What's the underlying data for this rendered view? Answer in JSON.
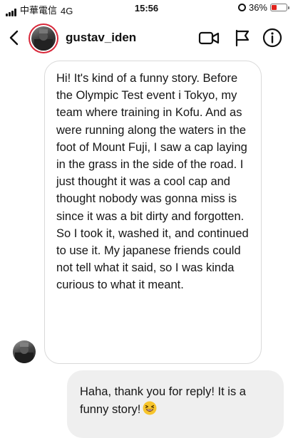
{
  "status_bar": {
    "carrier": "中華電信",
    "network": "4G",
    "time": "15:56",
    "battery": "36%"
  },
  "header": {
    "username": "gustav_iden"
  },
  "messages": [
    {
      "direction": "incoming",
      "text": "Hi! It's kind of a funny story. Before the Olympic Test event i Tokyo, my team where training in Kofu. And as were running along the waters in the foot of Mount Fuji, I saw a cap laying in the grass in the side of the road. I just thought it was a cool cap and thought nobody was gonna miss is since it was a bit dirty and forgotten. So I took it, washed it, and continued to use it. My japanese friends could not tell what it said, so I was kinda curious to what it meant."
    },
    {
      "direction": "outgoing",
      "text": "Haha, thank you for reply! It is a funny story!",
      "emoji": "laughing-face"
    }
  ],
  "colors": {
    "battery_low": "#e0231c",
    "story_ring": "#d8283a",
    "outgoing_bubble": "#efefef",
    "incoming_border": "#d9d9d9",
    "emoji_yellow": "#f7c52d"
  },
  "icons": {
    "back": "chevron-left-icon",
    "video": "video-camera-icon",
    "flag": "flag-icon",
    "info": "info-icon",
    "alarm": "alarm-clock-icon"
  }
}
